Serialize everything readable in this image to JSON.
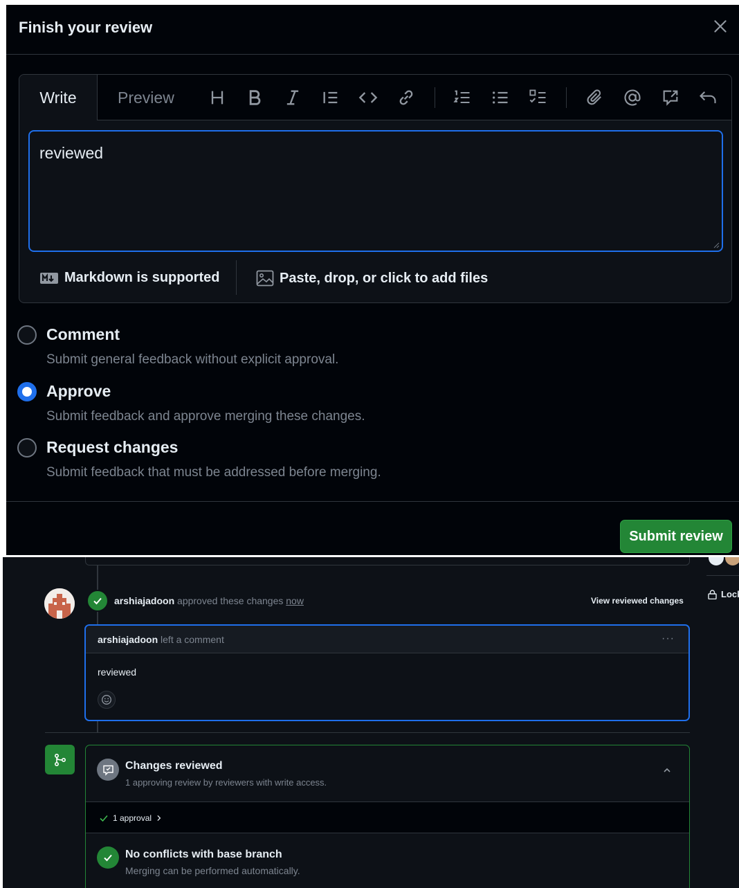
{
  "modal": {
    "title": "Finish your review",
    "tabs": {
      "write": "Write",
      "preview": "Preview"
    },
    "toolbar_icons": [
      "heading-icon",
      "bold-icon",
      "italic-icon",
      "quote-icon",
      "code-icon",
      "link-icon",
      "ordered-list-icon",
      "unordered-list-icon",
      "task-list-icon",
      "attach-icon",
      "mention-icon",
      "reference-icon",
      "undo-icon"
    ],
    "textarea_value": "reviewed",
    "markdown_note": "Markdown is supported",
    "files_note": "Paste, drop, or click to add files",
    "options": [
      {
        "label": "Comment",
        "desc": "Submit general feedback without explicit approval.",
        "checked": false
      },
      {
        "label": "Approve",
        "desc": "Submit feedback and approve merging these changes.",
        "checked": true
      },
      {
        "label": "Request changes",
        "desc": "Submit feedback that must be addressed before merging.",
        "checked": false
      }
    ],
    "submit_label": "Submit review"
  },
  "timeline": {
    "approval_user": "arshiajadoon",
    "approval_text": "approved these changes",
    "approval_time": "now",
    "view_changes": "View reviewed changes",
    "lock_label": "Lock",
    "comment": {
      "author": "arshiajadoon",
      "action": "left a comment",
      "menu": "···",
      "body": "reviewed"
    },
    "checks": {
      "review_title": "Changes reviewed",
      "review_sub": "1 approving review by reviewers with write access.",
      "approvals_link": "1 approval",
      "conflict_title": "No conflicts with base branch",
      "conflict_sub": "Merging can be performed automatically."
    }
  },
  "colors": {
    "accent_blue": "#1f6feb",
    "success_green": "#238636",
    "background_dark": "#0d1117"
  }
}
